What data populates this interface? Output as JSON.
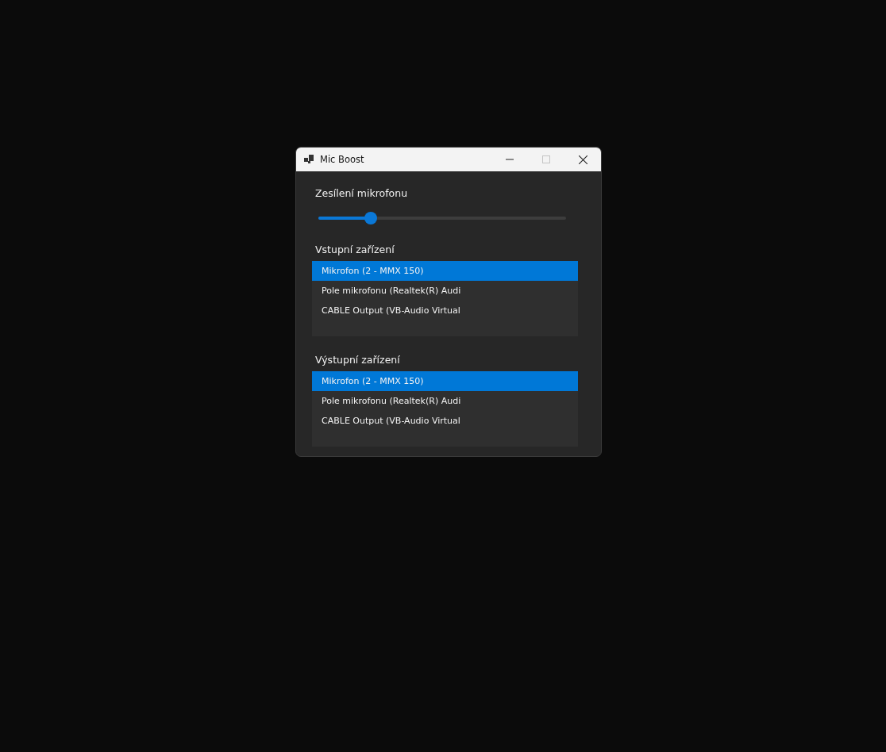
{
  "window": {
    "title": "Mic Boost",
    "maximize_disabled": true
  },
  "boost": {
    "label": "Zesílení mikrofonu",
    "level": 0.21
  },
  "lists": [
    {
      "label": "Vstupní zařízení",
      "items": [
        {
          "text": "Mikrofon (2 - MMX 150)",
          "selected": true
        },
        {
          "text": "Pole mikrofonu (Realtek(R) Audi",
          "selected": false
        },
        {
          "text": "CABLE Output (VB-Audio Virtual",
          "selected": false
        }
      ]
    },
    {
      "label": "Výstupní zařízení",
      "items": [
        {
          "text": "Mikrofon (2 - MMX 150)",
          "selected": true
        },
        {
          "text": "Pole mikrofonu (Realtek(R) Audi",
          "selected": false
        },
        {
          "text": "CABLE Output (VB-Audio Virtual",
          "selected": false
        }
      ]
    }
  ]
}
